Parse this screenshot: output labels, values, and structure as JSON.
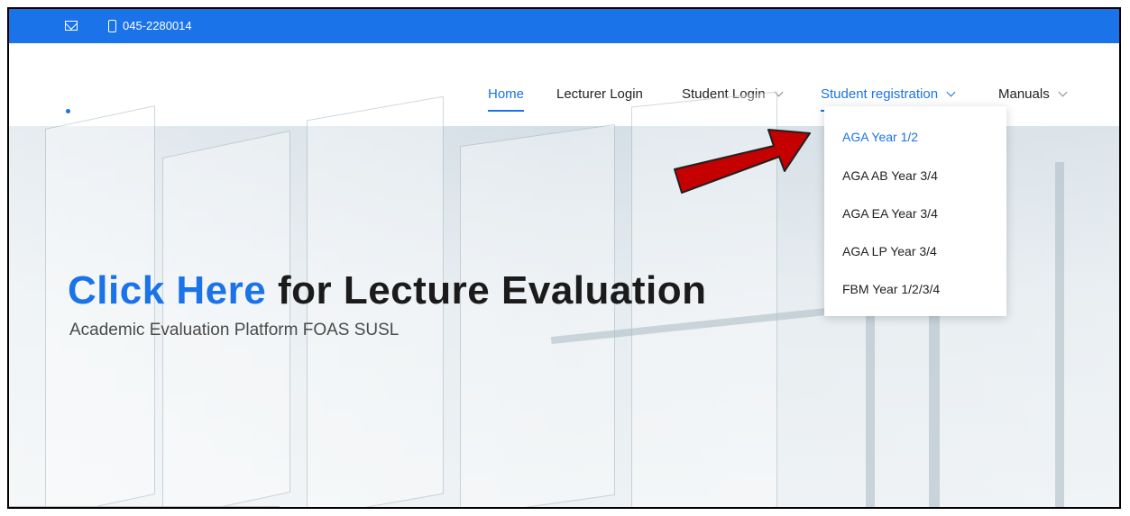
{
  "topbar": {
    "icons": [
      "envelope-icon",
      "phone-icon"
    ],
    "phone": "045-2280014"
  },
  "nav": {
    "items": [
      {
        "label": "Home",
        "active": true
      },
      {
        "label": "Lecturer Login"
      },
      {
        "label": "Student Login",
        "dropdown": true
      },
      {
        "label": "Student registration",
        "dropdown": true,
        "active_dropdown": true
      },
      {
        "label": "Manuals",
        "dropdown": true
      }
    ]
  },
  "dropdown": {
    "items": [
      "AGA Year 1/2",
      "AGA AB Year 3/4",
      "AGA EA Year 3/4",
      "AGA LP Year 3/4",
      "FBM Year 1/2/3/4"
    ]
  },
  "hero": {
    "title_highlight": "Click Here",
    "title_rest": " for Lecture Evaluation",
    "subtitle": "Academic Evaluation Platform FOAS SUSL"
  },
  "colors": {
    "accent": "#1a73e8",
    "arrow": "#c40000"
  }
}
